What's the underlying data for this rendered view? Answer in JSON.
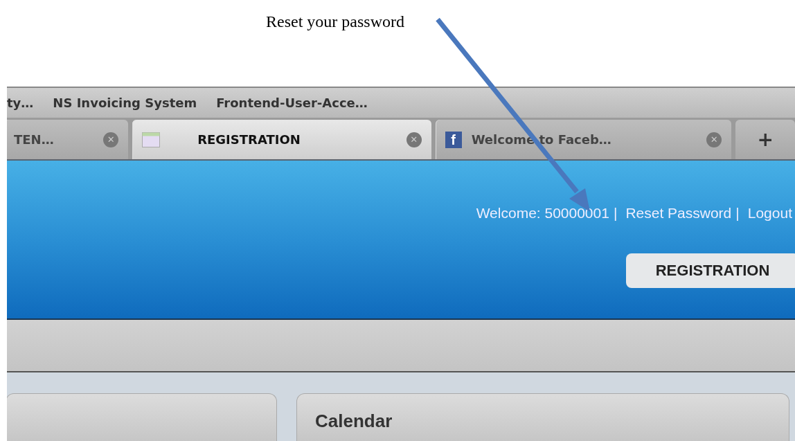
{
  "caption": "Reset your password",
  "bookmarks": [
    "ty…",
    "NS Invoicing System",
    "Frontend-User-Acce…"
  ],
  "tabs": [
    {
      "label": "TEN…",
      "selected": false,
      "icon": {
        "kind": "none"
      },
      "close": "✕"
    },
    {
      "label": "REGISTRATION",
      "selected": true,
      "icon": {
        "kind": "page"
      },
      "close": "✕"
    },
    {
      "label": "Welcome to Faceb…",
      "selected": false,
      "icon": {
        "kind": "letter",
        "glyph": "f"
      },
      "close": "✕"
    }
  ],
  "new_tab": "+",
  "header": {
    "items": [
      {
        "kind": "text",
        "text": "Welcome: 50000001"
      },
      {
        "kind": "separator",
        "text": "|"
      },
      {
        "kind": "link",
        "text": "Reset Password"
      },
      {
        "kind": "separator",
        "text": "|"
      },
      {
        "kind": "link",
        "text": "Logout"
      }
    ],
    "button": "REGISTRATION"
  },
  "panels": [
    {
      "kind": "blank"
    },
    {
      "kind": "titled",
      "title": "Calendar"
    }
  ]
}
